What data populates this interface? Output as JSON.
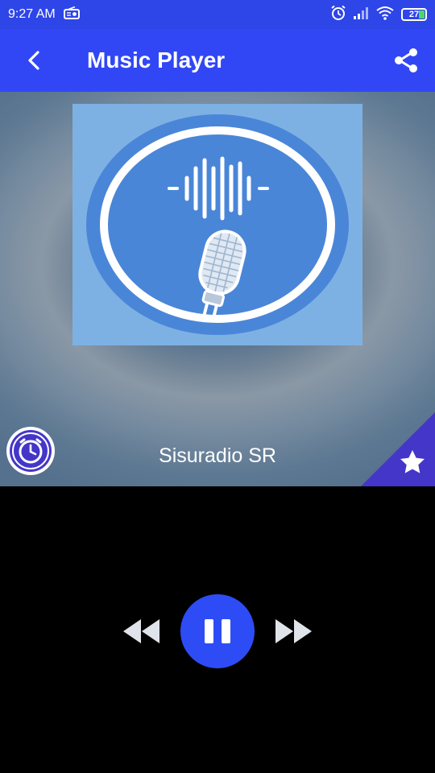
{
  "status_bar": {
    "time": "9:27 AM",
    "battery_level": "27",
    "icons": [
      "radio-icon",
      "alarm-icon",
      "signal-icon",
      "wifi-icon",
      "battery-icon"
    ]
  },
  "app_bar": {
    "title": "Music Player",
    "back_icon": "back-arrow-icon",
    "share_icon": "share-icon"
  },
  "player": {
    "station_name": "Sisuradio SR",
    "artwork": "microphone-soundwave-logo",
    "timer_icon": "clock-icon",
    "favorite_icon": "star-icon",
    "state": "playing"
  },
  "controls": {
    "rewind_icon": "rewind-icon",
    "pause_icon": "pause-icon",
    "forward_icon": "fast-forward-icon"
  },
  "colors": {
    "primary": "#3147f5",
    "status_bar": "#2e45e8",
    "accent_purple": "#4436c8",
    "artwork_bg": "#7eb1e3",
    "logo_blue": "#4a86d8"
  }
}
